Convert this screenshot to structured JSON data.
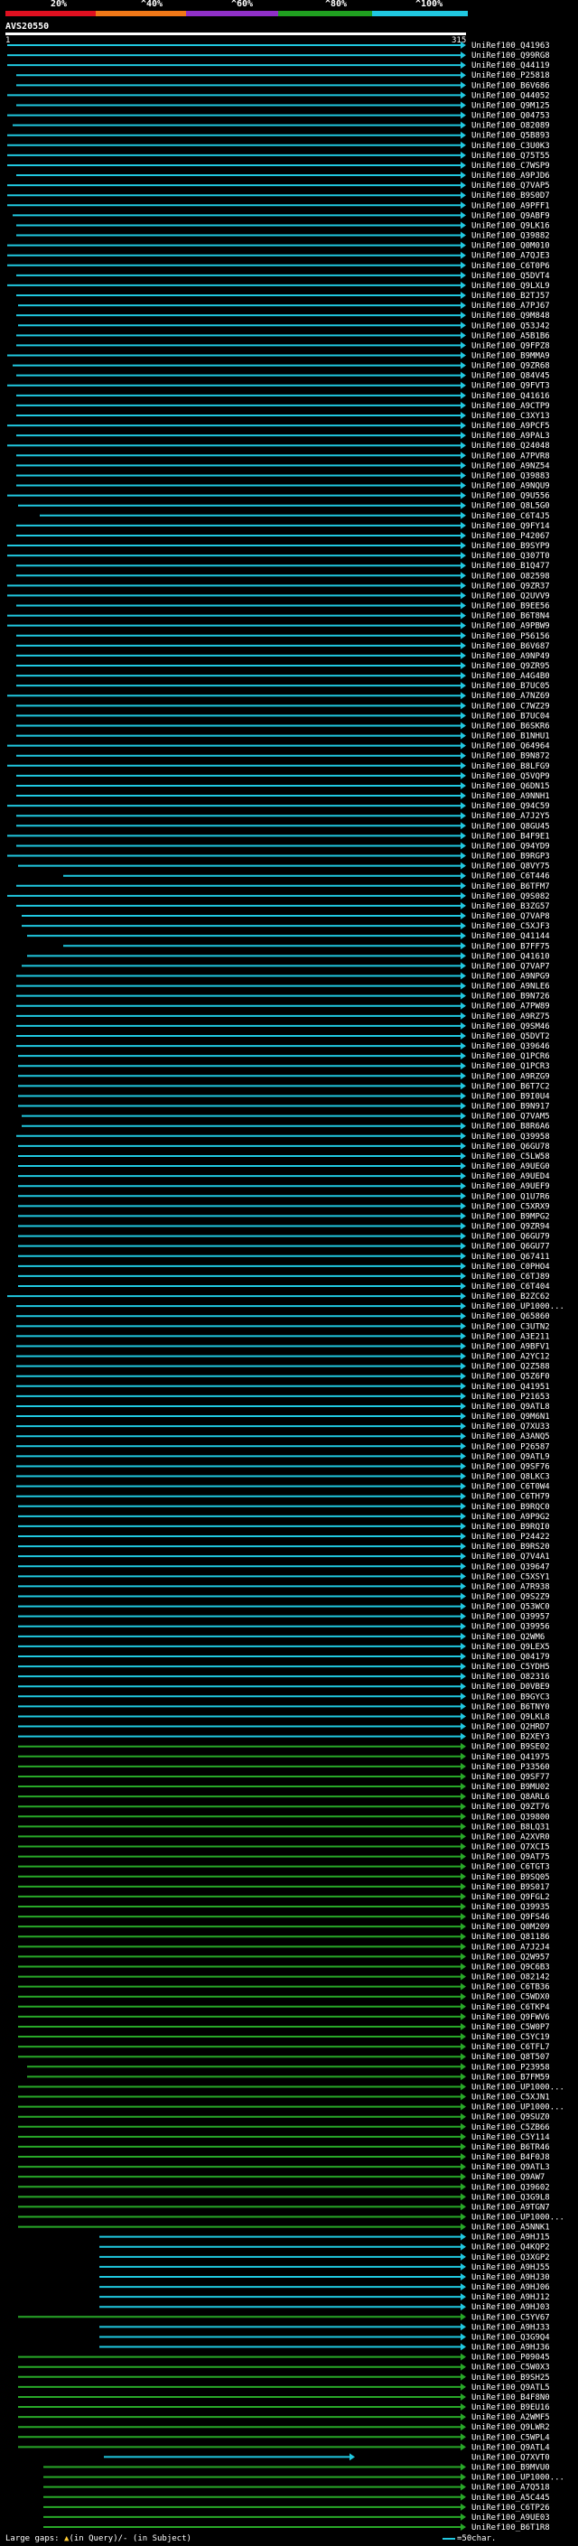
{
  "query": {
    "name": "AVS20550",
    "start": "1",
    "end": "315"
  },
  "scale": {
    "labels": [
      {
        "text": "20%",
        "color": "#ffffff"
      },
      {
        "text": "^40%",
        "color": "#ffffff"
      },
      {
        "text": "^60%",
        "color": "#ffffff"
      },
      {
        "text": "^80%",
        "color": "#ffffff"
      },
      {
        "text": "^100%",
        "color": "#ffffff"
      }
    ],
    "bands": [
      {
        "color": "#e01020"
      },
      {
        "color": "#f07818"
      },
      {
        "color": "#9030c8"
      },
      {
        "color": "#20a020"
      },
      {
        "color": "#20c8e0"
      }
    ]
  },
  "colors": {
    "cyan": "#20c8e0",
    "green": "#28a828",
    "query": "#ffffff",
    "gap_marker": "#ffcc33"
  },
  "legend": {
    "prefix": "Large gaps: ",
    "gap_glyph": "▲",
    "in_query": "(in Query)",
    "separator": "/- ",
    "in_subject": "(in Subject)",
    "scale_text": "=50char."
  },
  "hits": [
    [
      "UniRef100_Q41963",
      8,
      515,
      0
    ],
    [
      "UniRef100_Q99RG8",
      8,
      515,
      0
    ],
    [
      "UniRef100_Q44119",
      8,
      515,
      0
    ],
    [
      "UniRef100_P25818",
      18,
      515,
      0
    ],
    [
      "UniRef100_B6V686",
      18,
      515,
      0
    ],
    [
      "UniRef100_Q44052",
      8,
      515,
      0
    ],
    [
      "UniRef100_Q9M125",
      18,
      515,
      0
    ],
    [
      "UniRef100_Q04753",
      8,
      515,
      0
    ],
    [
      "UniRef100_O82089",
      14,
      515,
      0
    ],
    [
      "UniRef100_Q5B893",
      8,
      515,
      0
    ],
    [
      "UniRef100_C3U0K3",
      8,
      515,
      0
    ],
    [
      "UniRef100_Q75T55",
      8,
      515,
      0
    ],
    [
      "UniRef100_C7WSP9",
      8,
      515,
      0
    ],
    [
      "UniRef100_A9PJD6",
      18,
      515,
      0
    ],
    [
      "UniRef100_Q7VAP5",
      8,
      515,
      0
    ],
    [
      "UniRef100_B9S0D7",
      8,
      515,
      0
    ],
    [
      "UniRef100_A9PFF1",
      8,
      515,
      0
    ],
    [
      "UniRef100_Q9ABF9",
      14,
      515,
      0
    ],
    [
      "UniRef100_Q9LK16",
      18,
      515,
      0
    ],
    [
      "UniRef100_Q39882",
      18,
      515,
      0
    ],
    [
      "UniRef100_Q0M010",
      8,
      515,
      0
    ],
    [
      "UniRef100_A7QJE3",
      8,
      515,
      0
    ],
    [
      "UniRef100_C6T0P6",
      8,
      515,
      0
    ],
    [
      "UniRef100_Q5DVT4",
      18,
      515,
      0
    ],
    [
      "UniRef100_Q9LXL9",
      8,
      515,
      0
    ],
    [
      "UniRef100_B2TJ57",
      18,
      515,
      0
    ],
    [
      "UniRef100_A7PJ67",
      20,
      515,
      0
    ],
    [
      "UniRef100_Q9M848",
      18,
      515,
      0
    ],
    [
      "UniRef100_Q53J42",
      20,
      515,
      0
    ],
    [
      "UniRef100_A5B1B6",
      18,
      515,
      0
    ],
    [
      "UniRef100_Q9FPZ8",
      18,
      515,
      0
    ],
    [
      "UniRef100_B9MMA9",
      8,
      515,
      0
    ],
    [
      "UniRef100_Q9ZR68",
      14,
      515,
      0
    ],
    [
      "UniRef100_Q84V45",
      18,
      515,
      0
    ],
    [
      "UniRef100_Q9FVT3",
      8,
      515,
      0
    ],
    [
      "UniRef100_Q41616",
      18,
      515,
      0
    ],
    [
      "UniRef100_A9CTP9",
      18,
      515,
      0
    ],
    [
      "UniRef100_C3XY13",
      18,
      515,
      0
    ],
    [
      "UniRef100_A9PCF5",
      8,
      515,
      0
    ],
    [
      "UniRef100_A9PAL3",
      18,
      515,
      0
    ],
    [
      "UniRef100_Q24048",
      8,
      515,
      0
    ],
    [
      "UniRef100_A7PVR8",
      18,
      515,
      0
    ],
    [
      "UniRef100_A9NZ54",
      18,
      515,
      0
    ],
    [
      "UniRef100_Q39883",
      18,
      515,
      0
    ],
    [
      "UniRef100_A9NQU9",
      18,
      515,
      0
    ],
    [
      "UniRef100_Q9U556",
      8,
      515,
      0
    ],
    [
      "UniRef100_Q8L5G0",
      20,
      515,
      0
    ],
    [
      "UniRef100_C6T4J5",
      44,
      515,
      0
    ],
    [
      "UniRef100_Q9FY14",
      18,
      515,
      0
    ],
    [
      "UniRef100_P42067",
      18,
      515,
      0
    ],
    [
      "UniRef100_B9SYP9",
      8,
      515,
      0
    ],
    [
      "UniRef100_Q307T0",
      8,
      515,
      0
    ],
    [
      "UniRef100_B1Q477",
      18,
      515,
      0
    ],
    [
      "UniRef100_O82598",
      18,
      515,
      0
    ],
    [
      "UniRef100_Q9ZR37",
      8,
      515,
      0
    ],
    [
      "UniRef100_Q2UVV9",
      8,
      515,
      0
    ],
    [
      "UniRef100_B9EE56",
      18,
      515,
      0
    ],
    [
      "UniRef100_B6T8N4",
      8,
      515,
      0
    ],
    [
      "UniRef100_A9PBW9",
      8,
      515,
      0
    ],
    [
      "UniRef100_P56156",
      18,
      515,
      0
    ],
    [
      "UniRef100_B6V687",
      18,
      515,
      0
    ],
    [
      "UniRef100_A9NP49",
      18,
      515,
      0
    ],
    [
      "UniRef100_Q9ZR95",
      18,
      515,
      0
    ],
    [
      "UniRef100_A4G4B0",
      18,
      515,
      0
    ],
    [
      "UniRef100_B7UC05",
      18,
      515,
      0
    ],
    [
      "UniRef100_A7NZ69",
      8,
      515,
      0
    ],
    [
      "UniRef100_C7WZ29",
      18,
      515,
      0
    ],
    [
      "UniRef100_B7UC04",
      18,
      515,
      0
    ],
    [
      "UniRef100_B6SKR6",
      18,
      515,
      0
    ],
    [
      "UniRef100_B1NHU1",
      18,
      515,
      0
    ],
    [
      "UniRef100_Q64964",
      8,
      515,
      0
    ],
    [
      "UniRef100_B9N872",
      18,
      515,
      0
    ],
    [
      "UniRef100_B8LFG9",
      8,
      515,
      0
    ],
    [
      "UniRef100_Q5VQP9",
      18,
      515,
      0
    ],
    [
      "UniRef100_Q6DN15",
      18,
      515,
      0
    ],
    [
      "UniRef100_A9NNH1",
      18,
      515,
      0
    ],
    [
      "UniRef100_Q94C59",
      8,
      515,
      0
    ],
    [
      "UniRef100_A7J2Y5",
      18,
      515,
      0
    ],
    [
      "UniRef100_Q8GU45",
      18,
      515,
      0
    ],
    [
      "UniRef100_B4F9E1",
      8,
      515,
      0
    ],
    [
      "UniRef100_Q94YD9",
      18,
      515,
      0
    ],
    [
      "UniRef100_B9RGP3",
      8,
      515,
      0
    ],
    [
      "UniRef100_Q8VY75",
      20,
      515,
      0
    ],
    [
      "UniRef100_C6T446",
      70,
      515,
      0
    ],
    [
      "UniRef100_B6TFM7",
      18,
      515,
      0
    ],
    [
      "UniRef100_Q9S082",
      8,
      515,
      0
    ],
    [
      "UniRef100_B3ZG57",
      18,
      515,
      0
    ],
    [
      "UniRef100_Q7VAP8",
      24,
      515,
      0
    ],
    [
      "UniRef100_C5XJF3",
      24,
      515,
      0
    ],
    [
      "UniRef100_Q41144",
      30,
      515,
      0
    ],
    [
      "UniRef100_B7FF75",
      70,
      515,
      0
    ],
    [
      "UniRef100_Q41610",
      30,
      515,
      0
    ],
    [
      "UniRef100_Q7VAP7",
      24,
      515,
      0
    ],
    [
      "UniRef100_A9NPG9",
      18,
      515,
      0
    ],
    [
      "UniRef100_A9NLE6",
      18,
      515,
      0
    ],
    [
      "UniRef100_B9N726",
      18,
      515,
      0
    ],
    [
      "UniRef100_A7PW89",
      18,
      515,
      0
    ],
    [
      "UniRef100_A9RZ75",
      18,
      515,
      0
    ],
    [
      "UniRef100_Q9SM46",
      18,
      515,
      0
    ],
    [
      "UniRef100_Q5DVT2",
      18,
      515,
      0
    ],
    [
      "UniRef100_Q39646",
      18,
      515,
      0
    ],
    [
      "UniRef100_Q1PCR6",
      20,
      515,
      0
    ],
    [
      "UniRef100_Q1PCR3",
      20,
      515,
      0
    ],
    [
      "UniRef100_A9RZG9",
      20,
      515,
      0
    ],
    [
      "UniRef100_B6T7C2",
      20,
      515,
      0
    ],
    [
      "UniRef100_B9I0U4",
      20,
      515,
      0
    ],
    [
      "UniRef100_B9N917",
      20,
      515,
      0
    ],
    [
      "UniRef100_Q7VAM5",
      24,
      515,
      0
    ],
    [
      "UniRef100_B8R6A6",
      24,
      515,
      0
    ],
    [
      "UniRef100_Q39958",
      18,
      515,
      0
    ],
    [
      "UniRef100_Q6GU78",
      20,
      515,
      0
    ],
    [
      "UniRef100_C5LW58",
      20,
      515,
      0
    ],
    [
      "UniRef100_A9UEG0",
      20,
      515,
      0
    ],
    [
      "UniRef100_A9UED4",
      20,
      515,
      0
    ],
    [
      "UniRef100_A9UEF9",
      20,
      515,
      0
    ],
    [
      "UniRef100_Q1U7R6",
      20,
      515,
      0
    ],
    [
      "UniRef100_C5XRX9",
      20,
      515,
      0
    ],
    [
      "UniRef100_B9MPG2",
      20,
      515,
      0
    ],
    [
      "UniRef100_Q9ZR94",
      20,
      515,
      0
    ],
    [
      "UniRef100_Q6GU79",
      20,
      515,
      0
    ],
    [
      "UniRef100_Q6GU77",
      20,
      515,
      0
    ],
    [
      "UniRef100_Q67411",
      20,
      515,
      0
    ],
    [
      "UniRef100_C0PHO4",
      20,
      515,
      0
    ],
    [
      "UniRef100_C6TJ89",
      20,
      515,
      0
    ],
    [
      "UniRef100_C6T404",
      20,
      515,
      0
    ],
    [
      "UniRef100_B2ZC62",
      8,
      515,
      0
    ],
    [
      "UniRef100_UP1000...",
      18,
      515,
      0
    ],
    [
      "UniRef100_Q65860",
      18,
      515,
      0
    ],
    [
      "UniRef100_C3UTN2",
      18,
      515,
      0
    ],
    [
      "UniRef100_A3E211",
      18,
      515,
      0
    ],
    [
      "UniRef100_A9BFV1",
      18,
      515,
      0
    ],
    [
      "UniRef100_A2YC12",
      18,
      515,
      0
    ],
    [
      "UniRef100_Q2Z588",
      18,
      515,
      0
    ],
    [
      "UniRef100_Q5Z6F0",
      18,
      515,
      0
    ],
    [
      "UniRef100_Q41951",
      18,
      515,
      0
    ],
    [
      "UniRef100_P21653",
      18,
      515,
      0
    ],
    [
      "UniRef100_Q9ATL8",
      18,
      515,
      0
    ],
    [
      "UniRef100_Q9M6N1",
      18,
      515,
      0
    ],
    [
      "UniRef100_Q7XU33",
      18,
      515,
      0
    ],
    [
      "UniRef100_A3ANQ5",
      18,
      515,
      0
    ],
    [
      "UniRef100_P26587",
      18,
      515,
      0
    ],
    [
      "UniRef100_Q9ATL9",
      18,
      515,
      0
    ],
    [
      "UniRef100_Q9SF76",
      18,
      515,
      0
    ],
    [
      "UniRef100_Q8LKC3",
      18,
      515,
      0
    ],
    [
      "UniRef100_C6T0W4",
      18,
      515,
      0
    ],
    [
      "UniRef100_C6TH79",
      18,
      515,
      0
    ],
    [
      "UniRef100_B9RQC0",
      20,
      515,
      0
    ],
    [
      "UniRef100_A9P9G2",
      20,
      515,
      0
    ],
    [
      "UniRef100_B9RQI0",
      20,
      515,
      0
    ],
    [
      "UniRef100_P24422",
      20,
      515,
      0
    ],
    [
      "UniRef100_B9RS20",
      20,
      515,
      0
    ],
    [
      "UniRef100_Q7V4A1",
      20,
      515,
      0
    ],
    [
      "UniRef100_Q39647",
      20,
      515,
      0
    ],
    [
      "UniRef100_C5XSY1",
      20,
      515,
      0
    ],
    [
      "UniRef100_A7R938",
      20,
      515,
      0
    ],
    [
      "UniRef100_Q9S2Z9",
      20,
      515,
      0
    ],
    [
      "UniRef100_Q53WC0",
      20,
      515,
      0
    ],
    [
      "UniRef100_Q39957",
      20,
      515,
      0
    ],
    [
      "UniRef100_Q39956",
      20,
      515,
      0
    ],
    [
      "UniRef100_Q2WM6",
      20,
      515,
      0
    ],
    [
      "UniRef100_Q9LEX5",
      20,
      515,
      0
    ],
    [
      "UniRef100_Q04179",
      20,
      515,
      0
    ],
    [
      "UniRef100_C5YDH5",
      20,
      515,
      0
    ],
    [
      "UniRef100_O82316",
      20,
      515,
      0
    ],
    [
      "UniRef100_D0VBE9",
      20,
      515,
      0
    ],
    [
      "UniRef100_B9GYC3",
      20,
      515,
      0
    ],
    [
      "UniRef100_B6TNY0",
      20,
      515,
      0
    ],
    [
      "UniRef100_Q9LKL8",
      20,
      515,
      0
    ],
    [
      "UniRef100_Q2HRD7",
      20,
      515,
      0
    ],
    [
      "UniRef100_B2XEY3",
      20,
      515,
      0
    ],
    [
      "UniRef100_B9SE02",
      20,
      515,
      1
    ],
    [
      "UniRef100_Q41975",
      20,
      515,
      1
    ],
    [
      "UniRef100_P33560",
      20,
      515,
      1
    ],
    [
      "UniRef100_Q9SF77",
      20,
      515,
      1
    ],
    [
      "UniRef100_B9MU02",
      20,
      515,
      1
    ],
    [
      "UniRef100_Q8ARL6",
      20,
      515,
      1
    ],
    [
      "UniRef100_Q9ZT76",
      20,
      515,
      1
    ],
    [
      "UniRef100_Q39800",
      20,
      515,
      1
    ],
    [
      "UniRef100_B8LQ31",
      20,
      515,
      1
    ],
    [
      "UniRef100_A2XVR0",
      20,
      515,
      1
    ],
    [
      "UniRef100_Q7XCI5",
      20,
      515,
      1
    ],
    [
      "UniRef100_Q9AT75",
      20,
      515,
      1
    ],
    [
      "UniRef100_C6TGT3",
      20,
      515,
      1
    ],
    [
      "UniRef100_B9SQ05",
      20,
      515,
      1
    ],
    [
      "UniRef100_B9S017",
      20,
      515,
      1
    ],
    [
      "UniRef100_Q9FGL2",
      20,
      515,
      1
    ],
    [
      "UniRef100_Q39935",
      20,
      515,
      1
    ],
    [
      "UniRef100_Q9FS46",
      20,
      515,
      1
    ],
    [
      "UniRef100_Q0M209",
      20,
      515,
      1
    ],
    [
      "UniRef100_Q81186",
      20,
      515,
      1
    ],
    [
      "UniRef100_A7J2J4",
      20,
      515,
      1
    ],
    [
      "UniRef100_Q2W957",
      20,
      515,
      1
    ],
    [
      "UniRef100_Q9C6B3",
      20,
      515,
      1
    ],
    [
      "UniRef100_O82142",
      20,
      515,
      1
    ],
    [
      "UniRef100_C6TB36",
      20,
      515,
      1
    ],
    [
      "UniRef100_C5WDX0",
      20,
      515,
      1
    ],
    [
      "UniRef100_C6TKP4",
      20,
      515,
      1
    ],
    [
      "UniRef100_Q9FWV6",
      20,
      515,
      1
    ],
    [
      "UniRef100_C5W0P7",
      20,
      515,
      1
    ],
    [
      "UniRef100_C5YC19",
      20,
      515,
      1
    ],
    [
      "UniRef100_C6TFL7",
      20,
      515,
      1
    ],
    [
      "UniRef100_Q8T507",
      20,
      515,
      1
    ],
    [
      "UniRef100_P23958",
      30,
      515,
      1
    ],
    [
      "UniRef100_B7FM59",
      30,
      515,
      1
    ],
    [
      "UniRef100_UP1000...",
      20,
      515,
      1
    ],
    [
      "UniRef100_C5XJN1",
      20,
      515,
      1
    ],
    [
      "UniRef100_UP1000...",
      20,
      515,
      1
    ],
    [
      "UniRef100_Q9SUZ0",
      20,
      515,
      1
    ],
    [
      "UniRef100_C5ZB66",
      20,
      515,
      1
    ],
    [
      "UniRef100_C5Y114",
      20,
      515,
      1
    ],
    [
      "UniRef100_B6TR46",
      20,
      515,
      1
    ],
    [
      "UniRef100_B4F0J8",
      20,
      515,
      1
    ],
    [
      "UniRef100_Q9ATL3",
      20,
      515,
      1
    ],
    [
      "UniRef100_Q9AW7",
      20,
      515,
      1
    ],
    [
      "UniRef100_Q39602",
      20,
      515,
      1
    ],
    [
      "UniRef100_Q3G9L8",
      20,
      515,
      1
    ],
    [
      "UniRef100_A9TGN7",
      20,
      515,
      1
    ],
    [
      "UniRef100_UP1000...",
      20,
      515,
      1
    ],
    [
      "UniRef100_A5NNK1",
      20,
      515,
      1
    ],
    [
      "UniRef100_A9HJ15",
      110,
      515,
      0
    ],
    [
      "UniRef100_Q4KQP2",
      110,
      515,
      0
    ],
    [
      "UniRef100_Q3XGP2",
      110,
      515,
      0
    ],
    [
      "UniRef100_A9HJ55",
      110,
      515,
      0
    ],
    [
      "UniRef100_A9HJ30",
      110,
      515,
      0
    ],
    [
      "UniRef100_A9HJ06",
      110,
      515,
      0
    ],
    [
      "UniRef100_A9HJ12",
      110,
      515,
      0
    ],
    [
      "UniRef100_A9HJ03",
      110,
      515,
      0
    ],
    [
      "UniRef100_C5YV67",
      20,
      515,
      1
    ],
    [
      "UniRef100_A9HJ33",
      110,
      515,
      0
    ],
    [
      "UniRef100_Q3G9Q4",
      110,
      515,
      0
    ],
    [
      "UniRef100_A9HJ36",
      110,
      515,
      0
    ],
    [
      "UniRef100_P09045",
      20,
      515,
      1
    ],
    [
      "UniRef100_C5W0X3",
      20,
      515,
      1
    ],
    [
      "UniRef100_B9SH25",
      20,
      515,
      1
    ],
    [
      "UniRef100_Q9ATL5",
      20,
      515,
      1
    ],
    [
      "UniRef100_B4F8N0",
      20,
      515,
      1
    ],
    [
      "UniRef100_B9EU16",
      20,
      515,
      1
    ],
    [
      "UniRef100_A2WMF5",
      20,
      515,
      1
    ],
    [
      "UniRef100_Q9LWR2",
      20,
      515,
      1
    ],
    [
      "UniRef100_C5WPL4",
      20,
      515,
      1
    ],
    [
      "UniRef100_Q9ATL4",
      20,
      515,
      1
    ],
    [
      "UniRef100_Q7XVT0",
      115,
      392,
      0
    ],
    [
      "UniRef100_B9MVU0",
      48,
      515,
      1
    ],
    [
      "UniRef100_UP1000...",
      48,
      515,
      1
    ],
    [
      "UniRef100_A7Q518",
      48,
      515,
      1
    ],
    [
      "UniRef100_A5C445",
      48,
      515,
      1
    ],
    [
      "UniRef100_C6TP26",
      48,
      515,
      1
    ],
    [
      "UniRef100_A9UE03",
      48,
      515,
      1
    ],
    [
      "UniRef100_B6T1R8",
      48,
      515,
      1
    ]
  ]
}
